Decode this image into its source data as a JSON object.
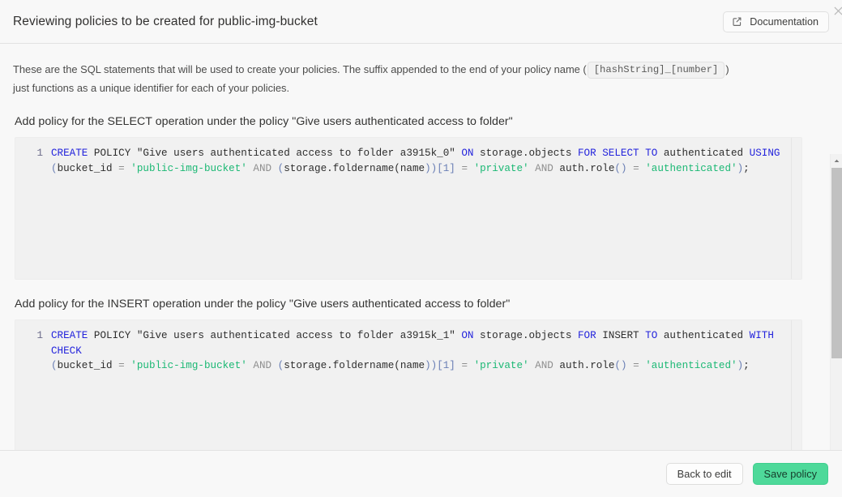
{
  "header": {
    "title": "Reviewing policies to be created for public-img-bucket",
    "documentation_label": "Documentation",
    "documentation_icon": "external-link-icon",
    "close_icon": "close-icon"
  },
  "intro": {
    "part1": "These are the SQL statements that will be used to create your policies. The suffix appended to the end of your policy name (",
    "code_badge": "[hashString]_[number]",
    "part2": ")",
    "part3": "just functions as a unique identifier for each of your policies."
  },
  "sections": [
    {
      "title": "Add policy for the SELECT operation under the policy \"Give users authenticated access to folder\"",
      "line_number": "1",
      "tokens": [
        {
          "t": "CREATE",
          "c": "kw"
        },
        {
          "t": " POLICY ",
          "c": "plain"
        },
        {
          "t": "\"Give users authenticated access to folder a3915k_0\" ",
          "c": "plain"
        },
        {
          "t": "ON",
          "c": "kw"
        },
        {
          "t": " storage.objects ",
          "c": "plain"
        },
        {
          "t": "FOR",
          "c": "kw"
        },
        {
          "t": " ",
          "c": "plain"
        },
        {
          "t": "SELECT",
          "c": "kw"
        },
        {
          "t": " ",
          "c": "plain"
        },
        {
          "t": "TO",
          "c": "kw"
        },
        {
          "t": " authenticated ",
          "c": "plain"
        },
        {
          "t": "USING",
          "c": "kw"
        },
        {
          "t": "\n",
          "c": "plain"
        },
        {
          "t": "(",
          "c": "pun"
        },
        {
          "t": "bucket_id ",
          "c": "plain"
        },
        {
          "t": "=",
          "c": "op"
        },
        {
          "t": " ",
          "c": "plain"
        },
        {
          "t": "'public-img-bucket'",
          "c": "str"
        },
        {
          "t": " ",
          "c": "plain"
        },
        {
          "t": "AND",
          "c": "op"
        },
        {
          "t": " ",
          "c": "plain"
        },
        {
          "t": "(",
          "c": "pun"
        },
        {
          "t": "storage.foldername(name",
          "c": "plain"
        },
        {
          "t": "))",
          "c": "pun"
        },
        {
          "t": "[1]",
          "c": "pun"
        },
        {
          "t": " ",
          "c": "plain"
        },
        {
          "t": "=",
          "c": "op"
        },
        {
          "t": " ",
          "c": "plain"
        },
        {
          "t": "'private'",
          "c": "str"
        },
        {
          "t": " ",
          "c": "plain"
        },
        {
          "t": "AND",
          "c": "op"
        },
        {
          "t": " auth.role",
          "c": "plain"
        },
        {
          "t": "()",
          "c": "pun"
        },
        {
          "t": " ",
          "c": "plain"
        },
        {
          "t": "=",
          "c": "op"
        },
        {
          "t": " ",
          "c": "plain"
        },
        {
          "t": "'authenticated'",
          "c": "str"
        },
        {
          "t": ")",
          "c": "pun"
        },
        {
          "t": ";",
          "c": "plain"
        }
      ],
      "sql_text": "CREATE POLICY \"Give users authenticated access to folder a3915k_0\" ON storage.objects FOR SELECT TO authenticated USING (bucket_id = 'public-img-bucket' AND (storage.foldername(name))[1] = 'private' AND auth.role() = 'authenticated');"
    },
    {
      "title": "Add policy for the INSERT operation under the policy \"Give users authenticated access to folder\"",
      "line_number": "1",
      "tokens": [
        {
          "t": "CREATE",
          "c": "kw"
        },
        {
          "t": " POLICY ",
          "c": "plain"
        },
        {
          "t": "\"Give users authenticated access to folder a3915k_1\" ",
          "c": "plain"
        },
        {
          "t": "ON",
          "c": "kw"
        },
        {
          "t": " storage.objects ",
          "c": "plain"
        },
        {
          "t": "FOR",
          "c": "kw"
        },
        {
          "t": " INSERT ",
          "c": "plain"
        },
        {
          "t": "TO",
          "c": "kw"
        },
        {
          "t": " authenticated ",
          "c": "plain"
        },
        {
          "t": "WITH CHECK",
          "c": "kw"
        },
        {
          "t": "\n",
          "c": "plain"
        },
        {
          "t": "(",
          "c": "pun"
        },
        {
          "t": "bucket_id ",
          "c": "plain"
        },
        {
          "t": "=",
          "c": "op"
        },
        {
          "t": " ",
          "c": "plain"
        },
        {
          "t": "'public-img-bucket'",
          "c": "str"
        },
        {
          "t": " ",
          "c": "plain"
        },
        {
          "t": "AND",
          "c": "op"
        },
        {
          "t": " ",
          "c": "plain"
        },
        {
          "t": "(",
          "c": "pun"
        },
        {
          "t": "storage.foldername(name",
          "c": "plain"
        },
        {
          "t": "))",
          "c": "pun"
        },
        {
          "t": "[1]",
          "c": "pun"
        },
        {
          "t": " ",
          "c": "plain"
        },
        {
          "t": "=",
          "c": "op"
        },
        {
          "t": " ",
          "c": "plain"
        },
        {
          "t": "'private'",
          "c": "str"
        },
        {
          "t": " ",
          "c": "plain"
        },
        {
          "t": "AND",
          "c": "op"
        },
        {
          "t": " auth.role",
          "c": "plain"
        },
        {
          "t": "()",
          "c": "pun"
        },
        {
          "t": " ",
          "c": "plain"
        },
        {
          "t": "=",
          "c": "op"
        },
        {
          "t": " ",
          "c": "plain"
        },
        {
          "t": "'authenticated'",
          "c": "str"
        },
        {
          "t": ")",
          "c": "pun"
        },
        {
          "t": ";",
          "c": "plain"
        }
      ],
      "sql_text": "CREATE POLICY \"Give users authenticated access to folder a3915k_1\" ON storage.objects FOR INSERT TO authenticated WITH CHECK (bucket_id = 'public-img-bucket' AND (storage.foldername(name))[1] = 'private' AND auth.role() = 'authenticated');"
    }
  ],
  "footer": {
    "back_label": "Back to edit",
    "save_label": "Save policy"
  },
  "colors": {
    "primary": "#4ed99a",
    "keyword": "#2323dc",
    "string": "#1bb874",
    "operator": "#8f8f8f",
    "punctuation": "#6a7fb5",
    "code_bg": "#f1f1f1",
    "page_bg": "#f8f8f8"
  }
}
